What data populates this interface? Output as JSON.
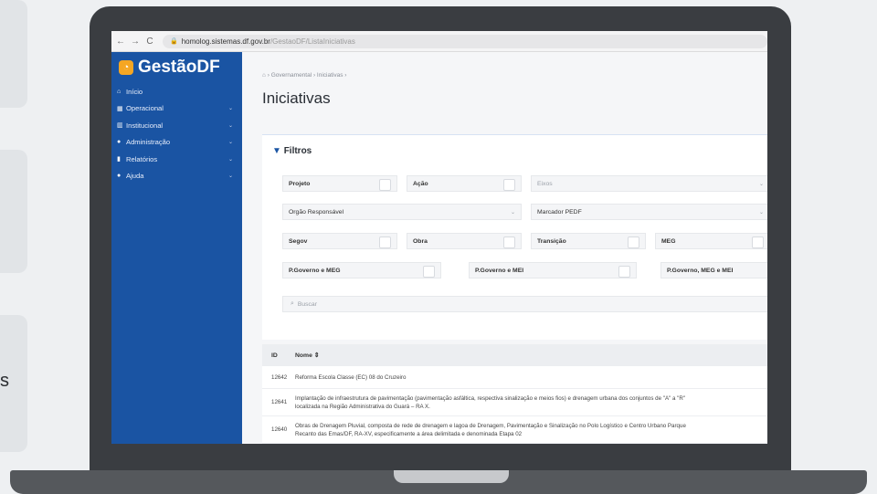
{
  "background": {
    "letter": "s"
  },
  "browser": {
    "back": "←",
    "forward": "→",
    "reload": "C",
    "url_domain": "homolog.sistemas.df.gov.br",
    "url_path": "/GestaoDF/ListaIniciativas"
  },
  "sidebar": {
    "brand": "GestãoDF",
    "items": [
      {
        "label": "Início",
        "icon": "home-icon"
      },
      {
        "label": "Operacional",
        "icon": "grid-icon",
        "caret": "⌄"
      },
      {
        "label": "Institucional",
        "icon": "building-icon",
        "caret": "⌄"
      },
      {
        "label": "Administração",
        "icon": "user-icon",
        "caret": "⌄"
      },
      {
        "label": "Relatórios",
        "icon": "chart-icon",
        "caret": "⌄"
      },
      {
        "label": "Ajuda",
        "icon": "help-icon",
        "caret": "⌄"
      }
    ]
  },
  "breadcrumb": {
    "home": "⌂",
    "items": "› Governamental › Iniciativas ›"
  },
  "page": {
    "title": "Iniciativas"
  },
  "filters": {
    "title": "Filtros",
    "projeto": "Projeto",
    "acao": "Ação",
    "eixos": "Eixos",
    "orgao": "Orgão Responsável",
    "marcador": "Marcador PEDF",
    "segov": "Segov",
    "obra": "Obra",
    "transicao": "Transição",
    "meg": "MEG",
    "pgov_meg": "P.Governo e MEG",
    "pgov_mei": "P.Governo e MEI",
    "pgov_meg_mei": "P.Governo, MEG e MEI",
    "search_placeholder": "Buscar",
    "caret": "⌄"
  },
  "table": {
    "col_id": "ID",
    "col_name": "Nome ⇕",
    "rows": [
      {
        "id": "12642",
        "name": "Reforma Escola Classe (EC) 08 do Cruzeiro",
        "name2": ""
      },
      {
        "id": "12641",
        "name": "Implantação de infraestrutura de pavimentação (pavimentação asfáltica, respectiva sinalização e meios fios) e drenagem urbana dos conjuntos de \"A\" a \"R\"",
        "name2": "localizada na Região Administrativa do Guará – RA X."
      },
      {
        "id": "12640",
        "name": "Obras de Drenagem Pluvial, composta de rede de drenagem e lagoa de Drenagem, Pavimentação e Sinalização no Polo Logístico e Centro Urbano Parque",
        "name2": "Recanto das Emas/DF, RA-XV, especificamente a área delimitada e denominada Etapa 02"
      }
    ]
  }
}
